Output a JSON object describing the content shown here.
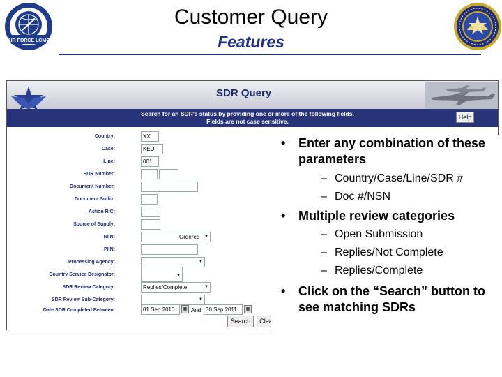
{
  "slide": {
    "title": "Customer Query",
    "subtitle": "Features"
  },
  "seals": {
    "left_text": "AIR FORCE LCMC"
  },
  "screenshot": {
    "app_title": "SDR Query",
    "instruction_line1": "Search for an SDR's status by providing one or more of the following fields.",
    "instruction_line2": "Fields are not case sensitive.",
    "help_label": "Help",
    "fields": [
      {
        "label": "Country:",
        "value": "XX"
      },
      {
        "label": "Case:",
        "value": "KEU"
      },
      {
        "label": "Line:",
        "value": "001"
      },
      {
        "label": "SDR Number:",
        "value": ""
      },
      {
        "label": "Document Number:",
        "value": ""
      },
      {
        "label": "Document Suffix:",
        "value": ""
      },
      {
        "label": "Action RIC:",
        "value": ""
      },
      {
        "label": "Source of Supply:",
        "value": ""
      },
      {
        "label": "NIIN:",
        "value": "Ordered"
      },
      {
        "label": "PIIN:",
        "value": ""
      },
      {
        "label": "Processing Agency:",
        "value": ""
      },
      {
        "label": "Country Service Designator:",
        "value": ""
      },
      {
        "label": "SDR Review Category:",
        "value": "Replies/Complete"
      },
      {
        "label": "SDR Review Sub-Category:",
        "value": ""
      },
      {
        "label": "Date SDR Completed Between:",
        "value": "01 Sep 2010"
      }
    ],
    "and_label": "And",
    "date_to": "30 Sep 2011",
    "search_label": "Search",
    "clear_label": "Clear"
  },
  "bullets": [
    {
      "text": "Enter any combination of these parameters",
      "subs": [
        "Country/Case/Line/SDR #",
        "Doc #/NSN"
      ]
    },
    {
      "text": "Multiple review categories",
      "subs": [
        "Open Submission",
        "Replies/Not Complete",
        "Replies/Complete"
      ]
    },
    {
      "text": "Click on the “Search” button to see matching SDRs",
      "subs": []
    }
  ],
  "colors": {
    "navy": "#1f2f8a",
    "bar": "#27347a"
  }
}
